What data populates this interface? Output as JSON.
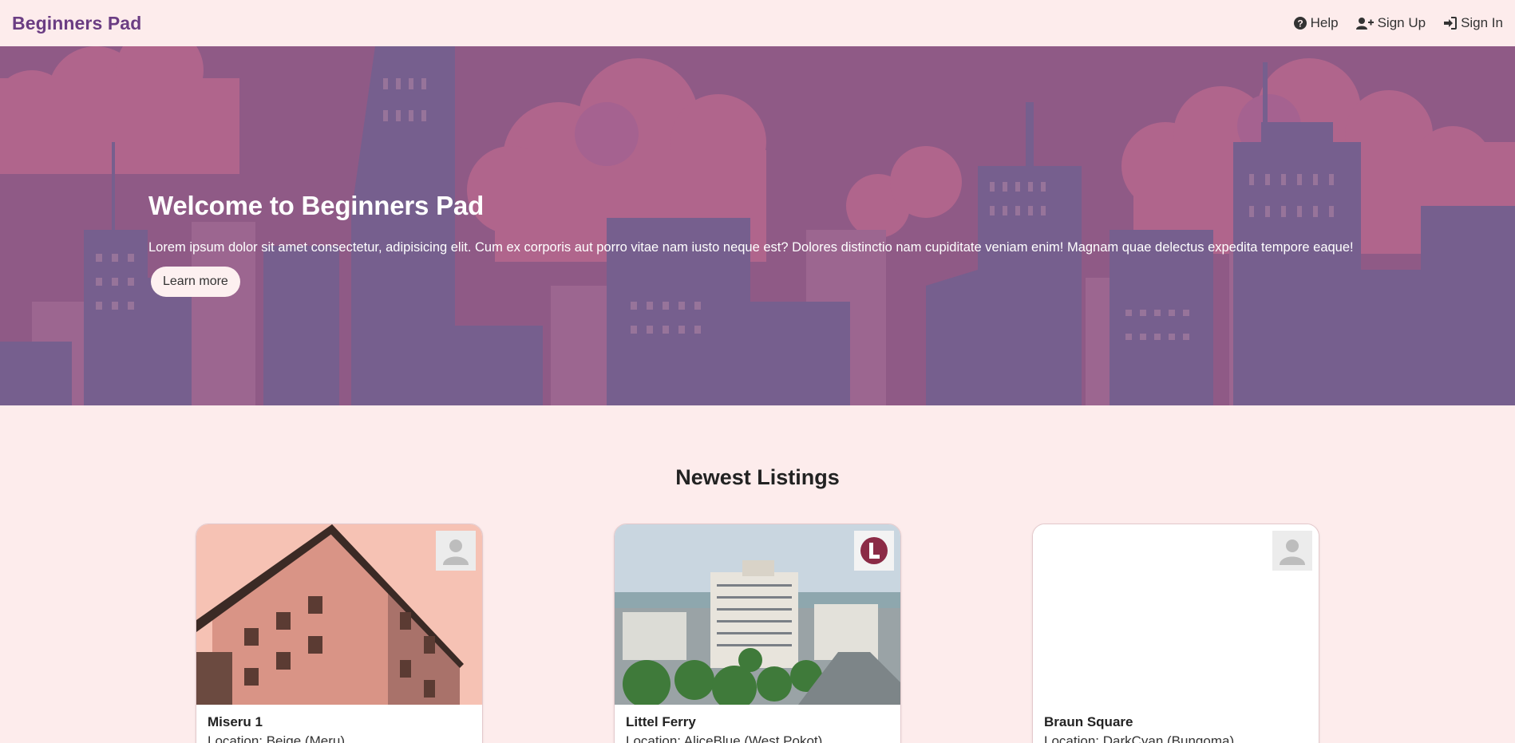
{
  "navbar": {
    "brand": "Beginners Pad",
    "links": [
      {
        "label": "Help",
        "icon": "question-circle-icon"
      },
      {
        "label": "Sign Up",
        "icon": "user-plus-icon"
      },
      {
        "label": "Sign In",
        "icon": "sign-in-icon"
      }
    ]
  },
  "hero": {
    "title": "Welcome to Beginners Pad",
    "text": "Lorem ipsum dolor sit amet consectetur, adipisicing elit. Cum ex corporis aut porro vitae nam iusto neque est? Dolores distinctio nam cupiditate veniam enim! Magnam quae delectus expedita tempore eaque!",
    "button_label": "Learn more"
  },
  "listings": {
    "title": "Newest Listings",
    "cards": [
      {
        "name": "Miseru 1",
        "location": "Location: Beige (Meru)",
        "image": "pink-apartment-building",
        "badge": "default-avatar"
      },
      {
        "name": "Littel Ferry",
        "location": "Location: AliceBlue (West Pokot)",
        "image": "town-street-view",
        "badge": "logo-L"
      },
      {
        "name": "Braun Square",
        "location": "Location: DarkCyan (Bungoma)",
        "image": "none",
        "badge": "default-avatar"
      }
    ]
  },
  "colors": {
    "background": "#fdecec",
    "brand": "#6b3d83",
    "hero": "#8e5a85"
  }
}
